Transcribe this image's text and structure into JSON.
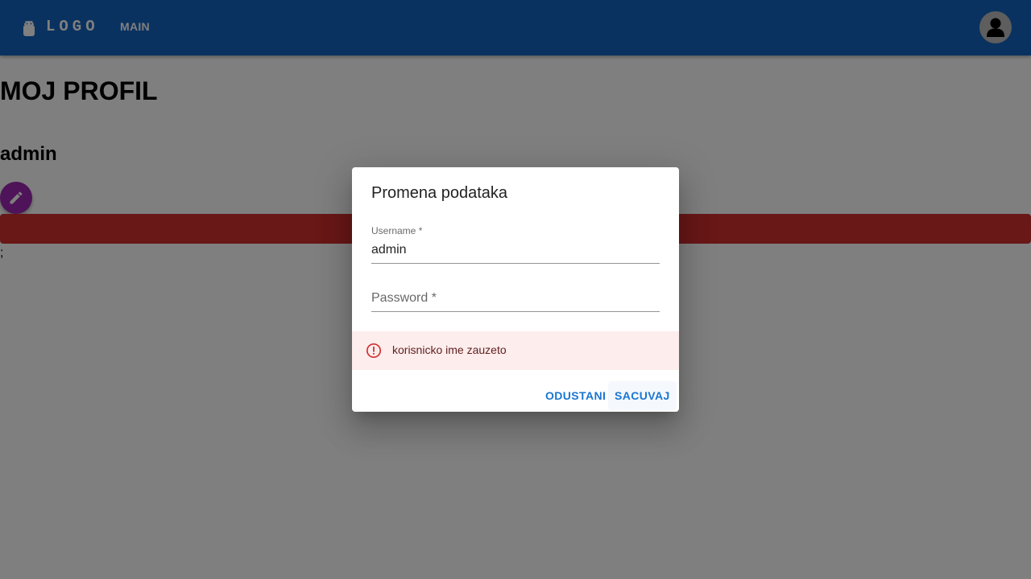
{
  "appbar": {
    "logo_text": "LOGO",
    "nav_main": "MAIN",
    "primary_color": "#1565c0"
  },
  "page": {
    "title": "MOJ PROFIL",
    "username": "admin",
    "trailing_text": ";",
    "error_bar_color": "#d32f2f",
    "fab_color": "#9c27b0"
  },
  "dialog": {
    "title": "Promena podataka",
    "username_field": {
      "label": "Username *",
      "value": "admin"
    },
    "password_field": {
      "label": "Password *",
      "value": ""
    },
    "alert": {
      "icon": "error-outline-icon",
      "message": "korisnicko ime zauzeto"
    },
    "actions": {
      "cancel_label": "ODUSTANI",
      "save_label": "SACUVAJ"
    }
  },
  "icons": {
    "logo": "android-icon",
    "avatar": "person-icon",
    "fab": "edit-pencil-icon"
  }
}
